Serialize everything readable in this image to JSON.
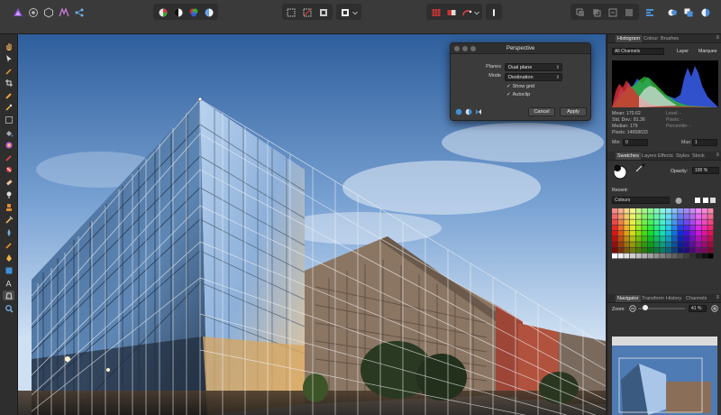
{
  "toolbar": {
    "persona_icons": [
      "photo-persona-icon",
      "liquify-persona-icon",
      "develop-persona-icon",
      "tone-mapping-persona-icon",
      "export-persona-icon"
    ],
    "colors": {
      "accent": "#4a90d9",
      "brand": "#8b4fd1"
    }
  },
  "dialog": {
    "title": "Perspective",
    "planes_label": "Planes",
    "planes_value": "Dual plane",
    "mode_label": "Mode",
    "mode_value": "Destination",
    "show_grid_label": "Show grid",
    "show_grid_checked": true,
    "autoclip_label": "Autoclip",
    "autoclip_checked": true,
    "cancel_label": "Cancel",
    "apply_label": "Apply"
  },
  "histogram": {
    "tabs": [
      "Histogram",
      "Colour",
      "Brushes"
    ],
    "channel": "All Channels",
    "layer_label": "Layer",
    "marquee_label": "Marquee",
    "stats": {
      "mean": "Mean: 170.62",
      "std_dev": "Std. Dev.: 81.36",
      "median": "Median: 179",
      "pixels": "Pixels: 14658633",
      "level": "Level: -",
      "count": "Pixels: -",
      "percentile": "Percentile: -"
    },
    "min_label": "Min:",
    "min_value": "0",
    "max_label": "Max:",
    "max_value": "1"
  },
  "swatches": {
    "tabs": [
      "Swatches",
      "Layers",
      "Effects",
      "Styles",
      "Stock"
    ],
    "opacity_label": "Opacity:",
    "opacity_value": "100 %",
    "recent_label": "Recent:",
    "palette_name": "Colours"
  },
  "navigator": {
    "tabs": [
      "Navigator",
      "Transform",
      "History",
      "Channels"
    ],
    "zoom_label": "Zoom:",
    "zoom_value": "41 %"
  }
}
